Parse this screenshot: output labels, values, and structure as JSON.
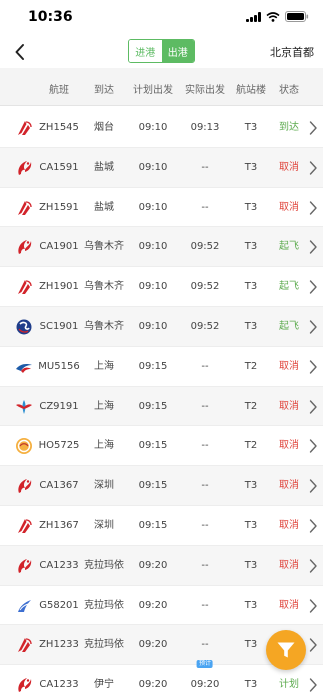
{
  "status_bar": {
    "time": "10:36"
  },
  "nav": {
    "tabs": [
      {
        "label": "进港",
        "active": false
      },
      {
        "label": "出港",
        "active": true
      }
    ],
    "airport": "北京首都"
  },
  "columns": [
    "航班",
    "到达",
    "计划出发",
    "实际出发",
    "航站楼",
    "状态"
  ],
  "colors": {
    "accent": "#5dbb63",
    "status_green": "#5dab4f",
    "status_red": "#e0453c",
    "fab": "#f5a623",
    "badge": "#4aa4f2"
  },
  "flights": [
    {
      "airline_icon": "shenzhen-airlines-logo",
      "flight": "ZH1545",
      "dest": "烟台",
      "planned": "09:10",
      "actual": "09:13",
      "terminal": "T3",
      "status": "到达",
      "status_color": "green"
    },
    {
      "airline_icon": "air-china-logo",
      "flight": "CA1591",
      "dest": "盐城",
      "planned": "09:10",
      "actual": "--",
      "terminal": "T3",
      "status": "取消",
      "status_color": "red"
    },
    {
      "airline_icon": "shenzhen-airlines-logo",
      "flight": "ZH1591",
      "dest": "盐城",
      "planned": "09:10",
      "actual": "--",
      "terminal": "T3",
      "status": "取消",
      "status_color": "red"
    },
    {
      "airline_icon": "air-china-logo",
      "flight": "CA1901",
      "dest": "乌鲁木齐",
      "planned": "09:10",
      "actual": "09:52",
      "terminal": "T3",
      "status": "起飞",
      "status_color": "green"
    },
    {
      "airline_icon": "shenzhen-airlines-logo",
      "flight": "ZH1901",
      "dest": "乌鲁木齐",
      "planned": "09:10",
      "actual": "09:52",
      "terminal": "T3",
      "status": "起飞",
      "status_color": "green"
    },
    {
      "airline_icon": "sichuan-airlines-logo",
      "flight": "SC1901",
      "dest": "乌鲁木齐",
      "planned": "09:10",
      "actual": "09:52",
      "terminal": "T3",
      "status": "起飞",
      "status_color": "green"
    },
    {
      "airline_icon": "china-eastern-logo",
      "flight": "MU5156",
      "dest": "上海",
      "planned": "09:15",
      "actual": "--",
      "terminal": "T2",
      "status": "取消",
      "status_color": "red"
    },
    {
      "airline_icon": "china-southern-logo",
      "flight": "CZ9191",
      "dest": "上海",
      "planned": "09:15",
      "actual": "--",
      "terminal": "T2",
      "status": "取消",
      "status_color": "red"
    },
    {
      "airline_icon": "juneyao-airlines-logo",
      "flight": "HO5725",
      "dest": "上海",
      "planned": "09:15",
      "actual": "--",
      "terminal": "T2",
      "status": "取消",
      "status_color": "red"
    },
    {
      "airline_icon": "air-china-logo",
      "flight": "CA1367",
      "dest": "深圳",
      "planned": "09:15",
      "actual": "--",
      "terminal": "T3",
      "status": "取消",
      "status_color": "red"
    },
    {
      "airline_icon": "shenzhen-airlines-logo",
      "flight": "ZH1367",
      "dest": "深圳",
      "planned": "09:15",
      "actual": "--",
      "terminal": "T3",
      "status": "取消",
      "status_color": "red"
    },
    {
      "airline_icon": "air-china-logo",
      "flight": "CA1233",
      "dest": "克拉玛依",
      "planned": "09:20",
      "actual": "--",
      "terminal": "T3",
      "status": "取消",
      "status_color": "red"
    },
    {
      "airline_icon": "grand-china-air-logo",
      "flight": "G58201",
      "dest": "克拉玛依",
      "planned": "09:20",
      "actual": "--",
      "terminal": "T3",
      "status": "取消",
      "status_color": "red"
    },
    {
      "airline_icon": "shenzhen-airlines-logo",
      "flight": "ZH1233",
      "dest": "克拉玛依",
      "planned": "09:20",
      "actual": "--",
      "terminal": "T3",
      "status": "取消",
      "status_color": "red"
    },
    {
      "airline_icon": "air-china-logo",
      "flight": "CA1233",
      "dest": "伊宁",
      "planned": "09:20",
      "actual": "09:20",
      "terminal": "T3",
      "status": "计划",
      "status_color": "green",
      "badge": "预计"
    }
  ],
  "filter_button": {
    "icon": "funnel-icon"
  }
}
